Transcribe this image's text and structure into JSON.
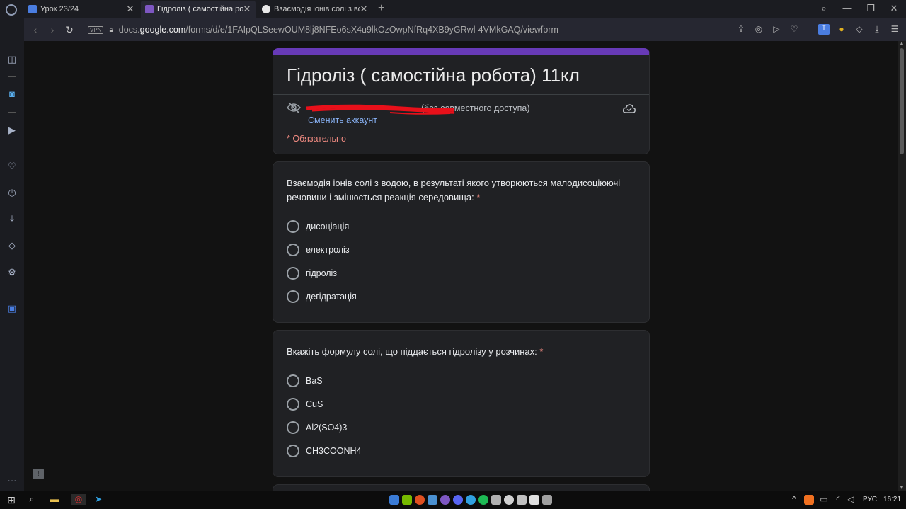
{
  "tabs": [
    {
      "label": "Урок 23/24",
      "active": false,
      "favicon_color": "#4a7de0"
    },
    {
      "label": "Гідроліз ( самостійна робо",
      "active": true,
      "favicon_color": "#7e57c2"
    },
    {
      "label": "Взаємодія іонів солі з вод",
      "active": false,
      "favicon_color": "#e8e8e8"
    }
  ],
  "address": {
    "vpn_badge": "VPN",
    "url_prefix": "docs.",
    "url_host": "google.com",
    "url_path": "/forms/d/e/1FAIpQLSeewOUM8lj8NFEo6sX4u9lkOzOwpNfRq4XB9yGRwl-4VMkGAQ/viewform"
  },
  "form": {
    "title": "Гідроліз ( самостійна робота) 11кл",
    "account_suffix": "(без совместного доступа)",
    "switch_account": "Сменить аккаунт",
    "required_note": "* Обязательно",
    "accent_color": "#673ab7"
  },
  "questions": [
    {
      "text": "Взаємодія іонів солі з водою, в результаті якого утворюються малодисоціюючі речовини і змінюється реакція середовища:",
      "required_mark": "*",
      "options": [
        "дисоціація",
        "електроліз",
        "гідроліз",
        "дегідратація"
      ]
    },
    {
      "text": "Вкажіть формулу солі, що піддається гідролізу у розчинах:",
      "required_mark": "*",
      "options": [
        "BaS",
        "CuS",
        "Al2(SO4)3",
        "CH3COONH4"
      ]
    }
  ],
  "taskbar": {
    "language": "РУС",
    "time": "16:21"
  }
}
